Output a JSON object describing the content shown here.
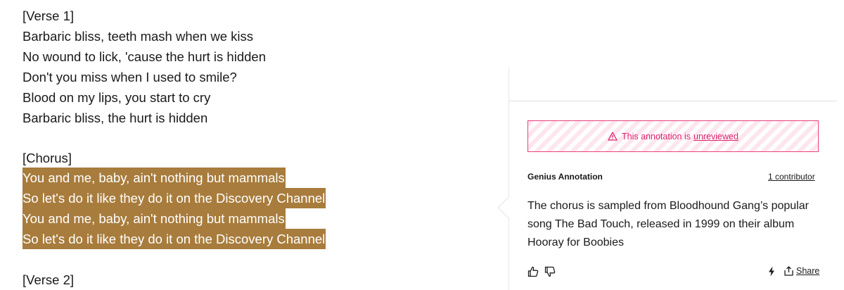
{
  "lyrics": [
    {
      "text": "[Verse 1]",
      "highlight": false
    },
    {
      "text": "Barbaric bliss, teeth mash when we kiss",
      "highlight": false
    },
    {
      "text": "No wound to lick, 'cause the hurt is hidden",
      "highlight": false
    },
    {
      "text": "Don't you miss when I used to smile?",
      "highlight": false
    },
    {
      "text": "Blood on my lips, you start to cry",
      "highlight": false
    },
    {
      "text": "Barbaric bliss, the hurt is hidden",
      "highlight": false
    },
    {
      "text": "[Chorus]",
      "highlight": false
    },
    {
      "text": "You and me, baby, ain't nothing but mammals",
      "highlight": true
    },
    {
      "text": "So let's do it like they do it on the Discovery Channel",
      "highlight": true
    },
    {
      "text": "You and me, baby, ain't nothing but mammals",
      "highlight": true
    },
    {
      "text": "So let's do it like they do it on the Discovery Channel",
      "highlight": true
    },
    {
      "text": "[Verse 2]",
      "highlight": false
    }
  ],
  "annotation": {
    "warning_prefix": "This annotation is",
    "warning_link": "unreviewed",
    "label": "Genius Annotation",
    "contributors": "1 contributor",
    "body": "The chorus is sampled from Bloodhound Gang’s popular song The Bad Touch, released in 1999 on their album Hooray for Boobies",
    "share_label": "Share"
  },
  "colors": {
    "highlight": "#a87c3c",
    "warning": "#d9246c"
  },
  "icons": {
    "warning": "warning-triangle-icon",
    "upvote": "thumbs-up-icon",
    "downvote": "thumbs-down-icon",
    "bolt": "lightning-icon",
    "share": "share-icon"
  }
}
